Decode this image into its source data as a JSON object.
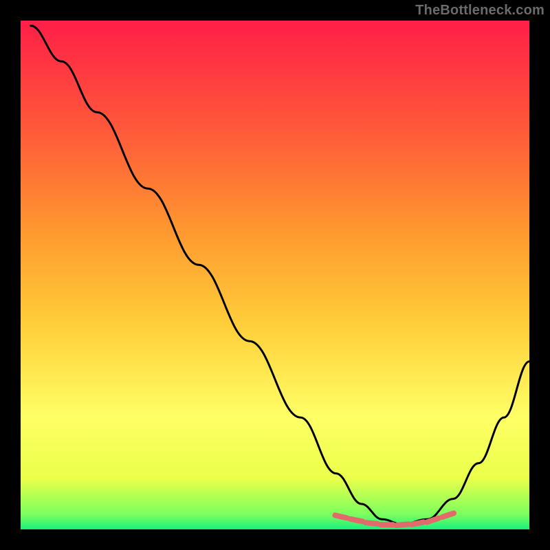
{
  "watermark": "TheBottleneck.com",
  "chart_data": {
    "type": "line",
    "title": "",
    "xlabel": "",
    "ylabel": "",
    "xlim": [
      0,
      1
    ],
    "ylim": [
      0,
      1
    ],
    "background_gradient": {
      "top": "#ff1f47",
      "upper_mid": "#ff8a2a",
      "mid": "#ffd23a",
      "lower_mid": "#ffff66",
      "near_bottom": "#eaff4a",
      "bottom": "#19f07e"
    },
    "series": [
      {
        "name": "bottleneck-curve",
        "color": "#000000",
        "x": [
          0.02,
          0.08,
          0.15,
          0.25,
          0.35,
          0.45,
          0.55,
          0.62,
          0.67,
          0.71,
          0.75,
          0.8,
          0.85,
          0.9,
          0.95,
          1.0
        ],
        "y": [
          0.99,
          0.92,
          0.82,
          0.67,
          0.52,
          0.37,
          0.22,
          0.11,
          0.05,
          0.02,
          0.01,
          0.02,
          0.06,
          0.13,
          0.22,
          0.33
        ]
      }
    ],
    "dashed_segment": {
      "name": "trough-dashes",
      "color": "#e36a6a",
      "x": [
        0.63,
        0.66,
        0.69,
        0.72,
        0.75,
        0.78,
        0.81,
        0.84
      ],
      "y": [
        0.025,
        0.018,
        0.012,
        0.009,
        0.009,
        0.012,
        0.018,
        0.028
      ]
    }
  }
}
